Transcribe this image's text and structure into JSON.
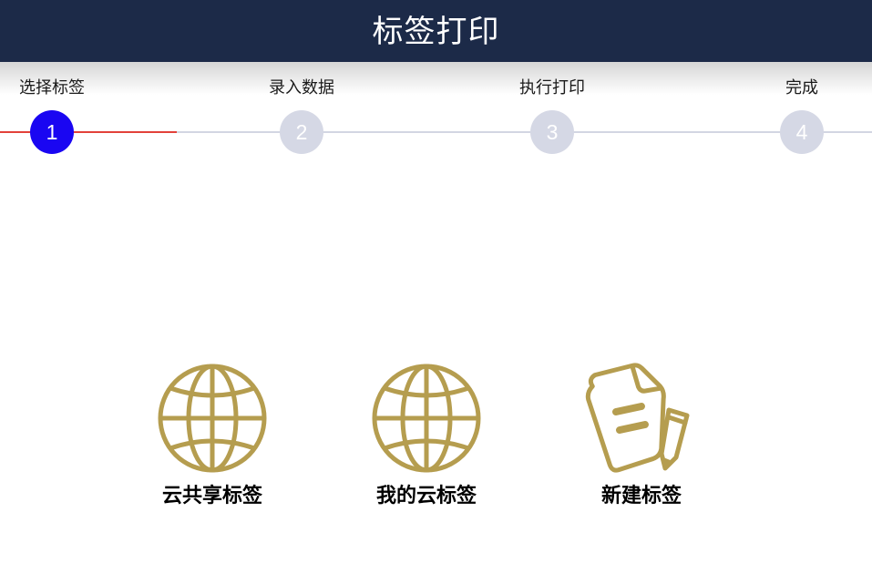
{
  "header": {
    "title": "标签打印"
  },
  "steps": [
    {
      "label": "选择标签",
      "number": "1",
      "active": true
    },
    {
      "label": "录入数据",
      "number": "2",
      "active": false
    },
    {
      "label": "执行打印",
      "number": "3",
      "active": false
    },
    {
      "label": "完成",
      "number": "4",
      "active": false
    }
  ],
  "options": [
    {
      "label": "云共享标签",
      "icon": "globe-icon"
    },
    {
      "label": "我的云标签",
      "icon": "globe-icon"
    },
    {
      "label": "新建标签",
      "icon": "document-pencil-icon"
    }
  ],
  "colors": {
    "header_bg": "#1c2a48",
    "active_step": "#1a06f2",
    "inactive_step": "#d5d8e5",
    "progress_done": "#e2413a",
    "icon_gold": "#b59d4f"
  }
}
